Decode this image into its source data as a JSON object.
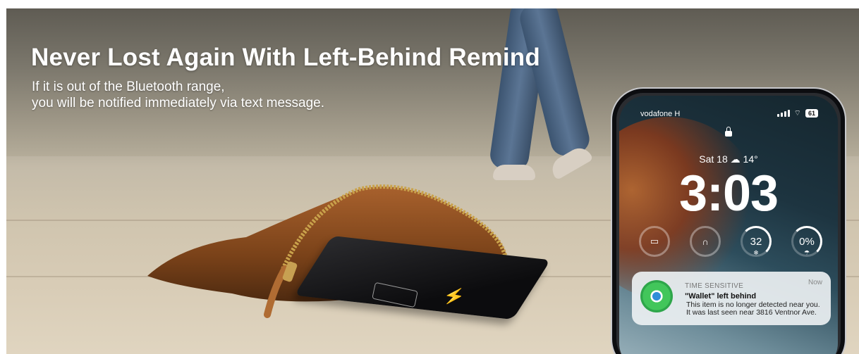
{
  "headline": "Never Lost Again With Left-Behind Remind",
  "subtext": {
    "line1": "If it is out of the Bluetooth range,",
    "line2": "you will be notified immediately via text message."
  },
  "phone": {
    "carrier": "vodafone H",
    "battery": "61",
    "date_weather": "Sat 18 ☁ 14°",
    "time": "3:03",
    "widgets": [
      {
        "icon": "wallet-icon",
        "value": ""
      },
      {
        "icon": "airpods-icon",
        "value": ""
      },
      {
        "icon": "temperature-icon",
        "value": "32"
      },
      {
        "icon": "rain-chance-icon",
        "value": "0%"
      }
    ]
  },
  "notification": {
    "tag": "TIME SENSITIVE",
    "time": "Now",
    "title": "\"Wallet\" left behind",
    "body_line1": "This item is no longer detected near you.",
    "body_line2": "It was last seen near 3816 Ventnor Ave."
  }
}
